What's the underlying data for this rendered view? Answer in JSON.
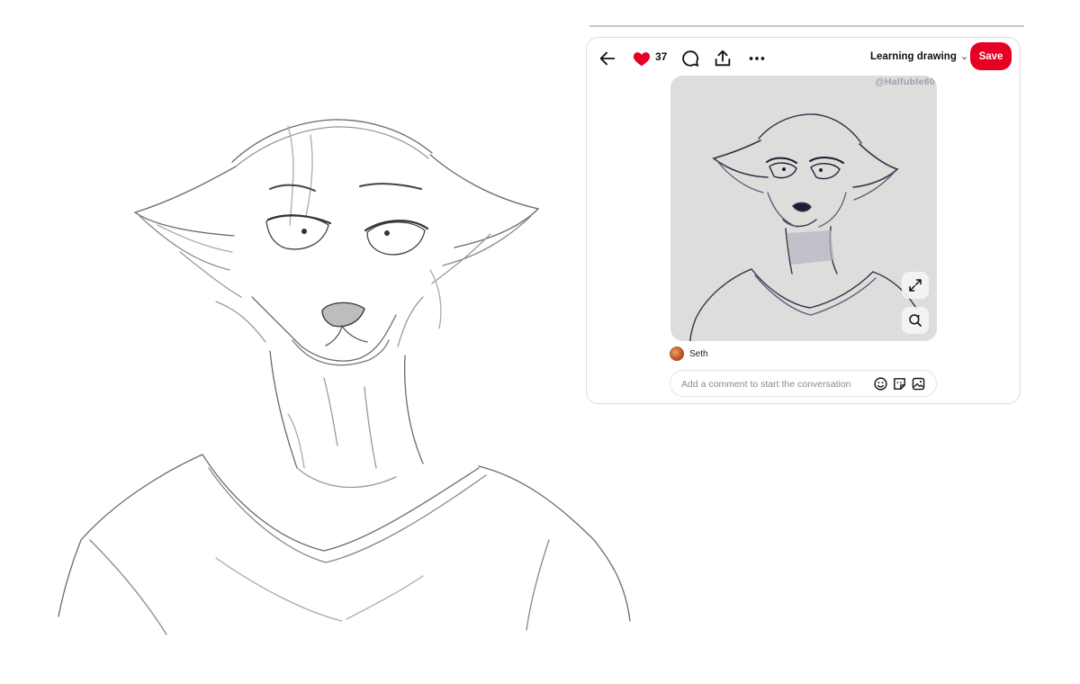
{
  "toolbar": {
    "like_count": "37",
    "board_name": "Learning drawing",
    "save_label": "Save"
  },
  "pin": {
    "watermark": "@Halfuble60",
    "author_name": "Seth"
  },
  "comment": {
    "placeholder": "Add a comment to start the conversation"
  },
  "icons": {
    "back": "back-arrow-icon",
    "like": "heart-icon",
    "comment": "comment-bubble-icon",
    "share": "share-icon",
    "more": "more-dots-icon",
    "expand": "expand-icon",
    "visual_search": "visual-search-icon",
    "emoji": "emoji-icon",
    "sticker": "sticker-icon",
    "image": "image-icon"
  },
  "colors": {
    "save_button": "#e60023",
    "heart": "#e60023"
  }
}
